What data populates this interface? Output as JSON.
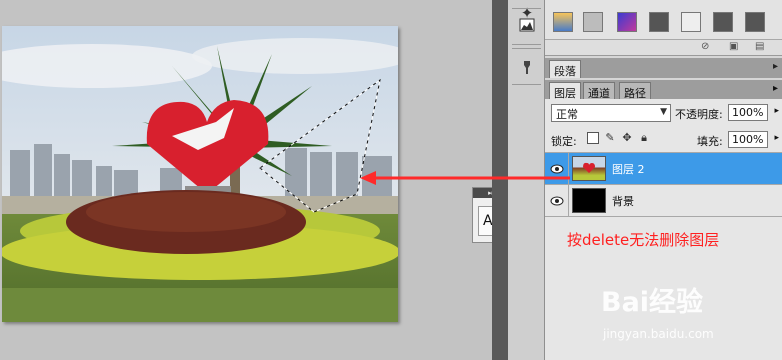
{
  "panel": {
    "tabs_top": [
      "段落"
    ],
    "tabs": [
      "图层",
      "通道",
      "路径"
    ],
    "blend_mode": "正常",
    "opacity_label": "不透明度:",
    "opacity_value": "100%",
    "lock_label": "锁定:",
    "fill_label": "填充:",
    "fill_value": "100%",
    "layers": [
      {
        "name": "图层 2",
        "selected": true,
        "visible": true
      },
      {
        "name": "背景",
        "selected": false,
        "visible": true
      }
    ]
  },
  "text_tool_sample": "A|",
  "annotation": "按delete无法删除图层",
  "watermark": {
    "brand": "Bai经验",
    "url": "jingyan.baidu.com"
  },
  "colors": {
    "selection": "#3d9ae8",
    "annotation": "#ff2020",
    "dock": "#595959"
  },
  "icons": [
    "eye-icon",
    "histogram-icon",
    "brush-tool-icon",
    "lock-icon",
    "move-icon",
    "transparency-lock-icon",
    "panel-menu-icon"
  ]
}
